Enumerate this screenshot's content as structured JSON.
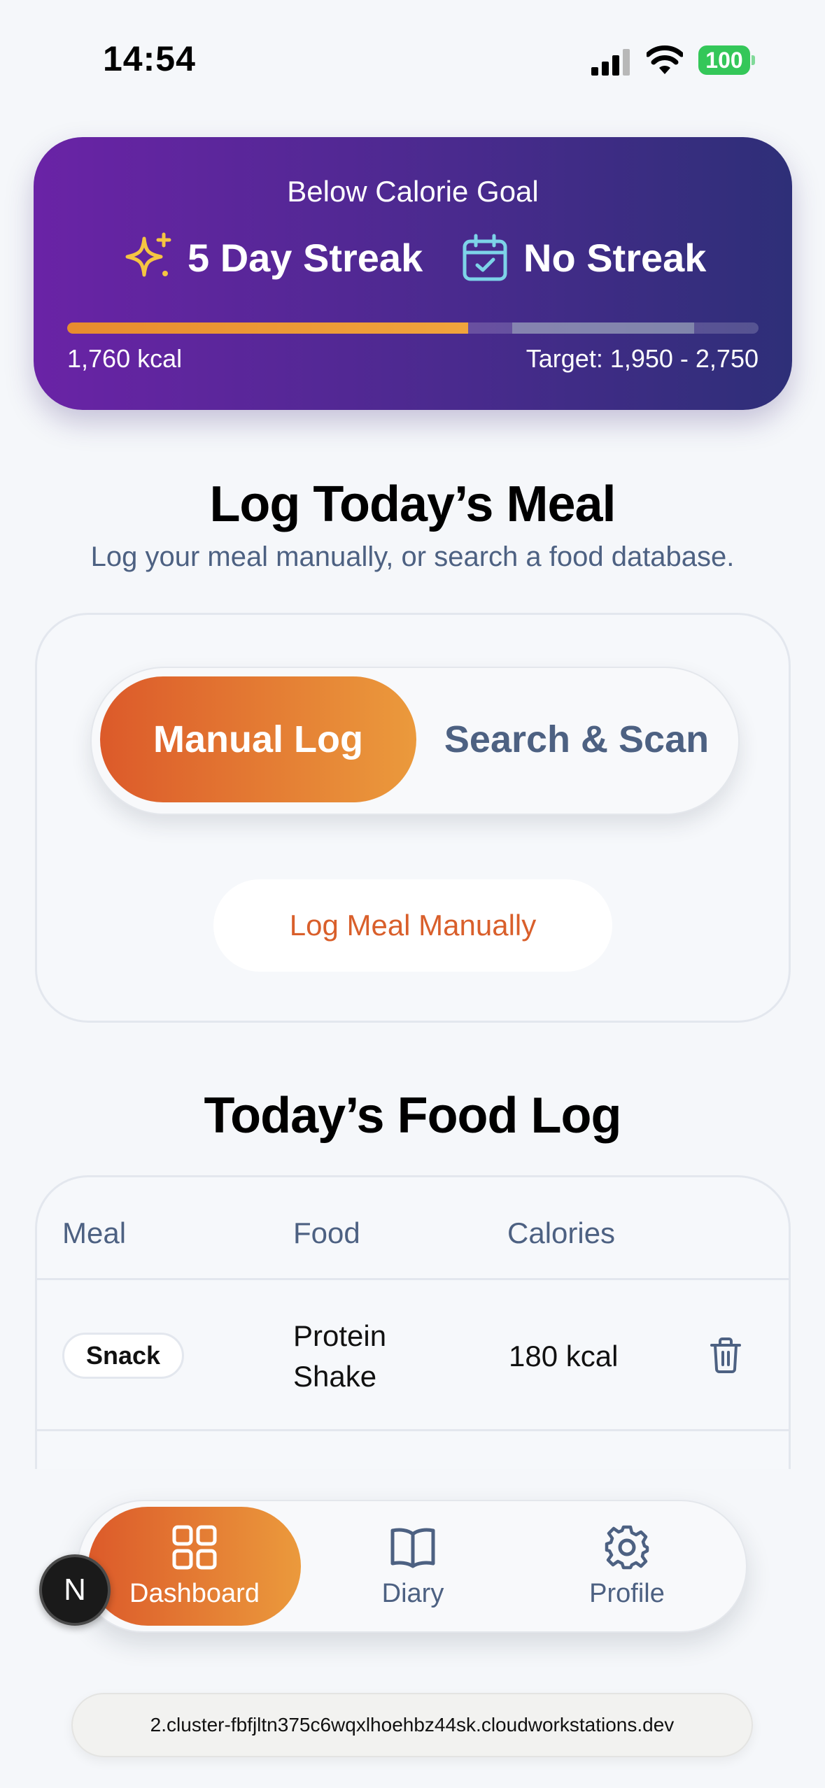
{
  "status_bar": {
    "time": "14:54",
    "battery": "100"
  },
  "streak_card": {
    "heading": "Below Calorie Goal",
    "streak_primary": "5 Day Streak",
    "streak_secondary": "No Streak",
    "current_kcal": "1,760 kcal",
    "target_text": "Target: 1,950 - 2,750",
    "progress_fraction": 0.58,
    "colors": {
      "gradient_start": "#6a23a6",
      "gradient_end": "#2e2f78",
      "progress": "#e88c2e",
      "sparkle": "#f5c542",
      "calendar": "#7dd3e8"
    }
  },
  "log_section": {
    "title": "Log Today’s Meal",
    "subtitle": "Log your meal manually, or search a food database.",
    "toggle": {
      "active": "Manual Log",
      "inactive": "Search & Scan"
    },
    "manual_button": "Log Meal Manually"
  },
  "food_log": {
    "title": "Today’s Food Log",
    "columns": [
      "Meal",
      "Food",
      "Calories"
    ],
    "rows": [
      {
        "meal": "Snack",
        "food": "Protein Shake",
        "calories": "180 kcal",
        "action_icon": "trash-icon"
      }
    ]
  },
  "bottom_nav": {
    "items": [
      {
        "label": "Dashboard",
        "icon": "grid-icon",
        "active": true
      },
      {
        "label": "Diary",
        "icon": "book-icon",
        "active": false
      },
      {
        "label": "Profile",
        "icon": "gear-icon",
        "active": false
      }
    ]
  },
  "dev_badge": "N",
  "url_bar": "2.cluster-fbfjltn375c6wqxlhoehbz44sk.cloudworkstations.dev",
  "accent_color": "#dc5a2a"
}
